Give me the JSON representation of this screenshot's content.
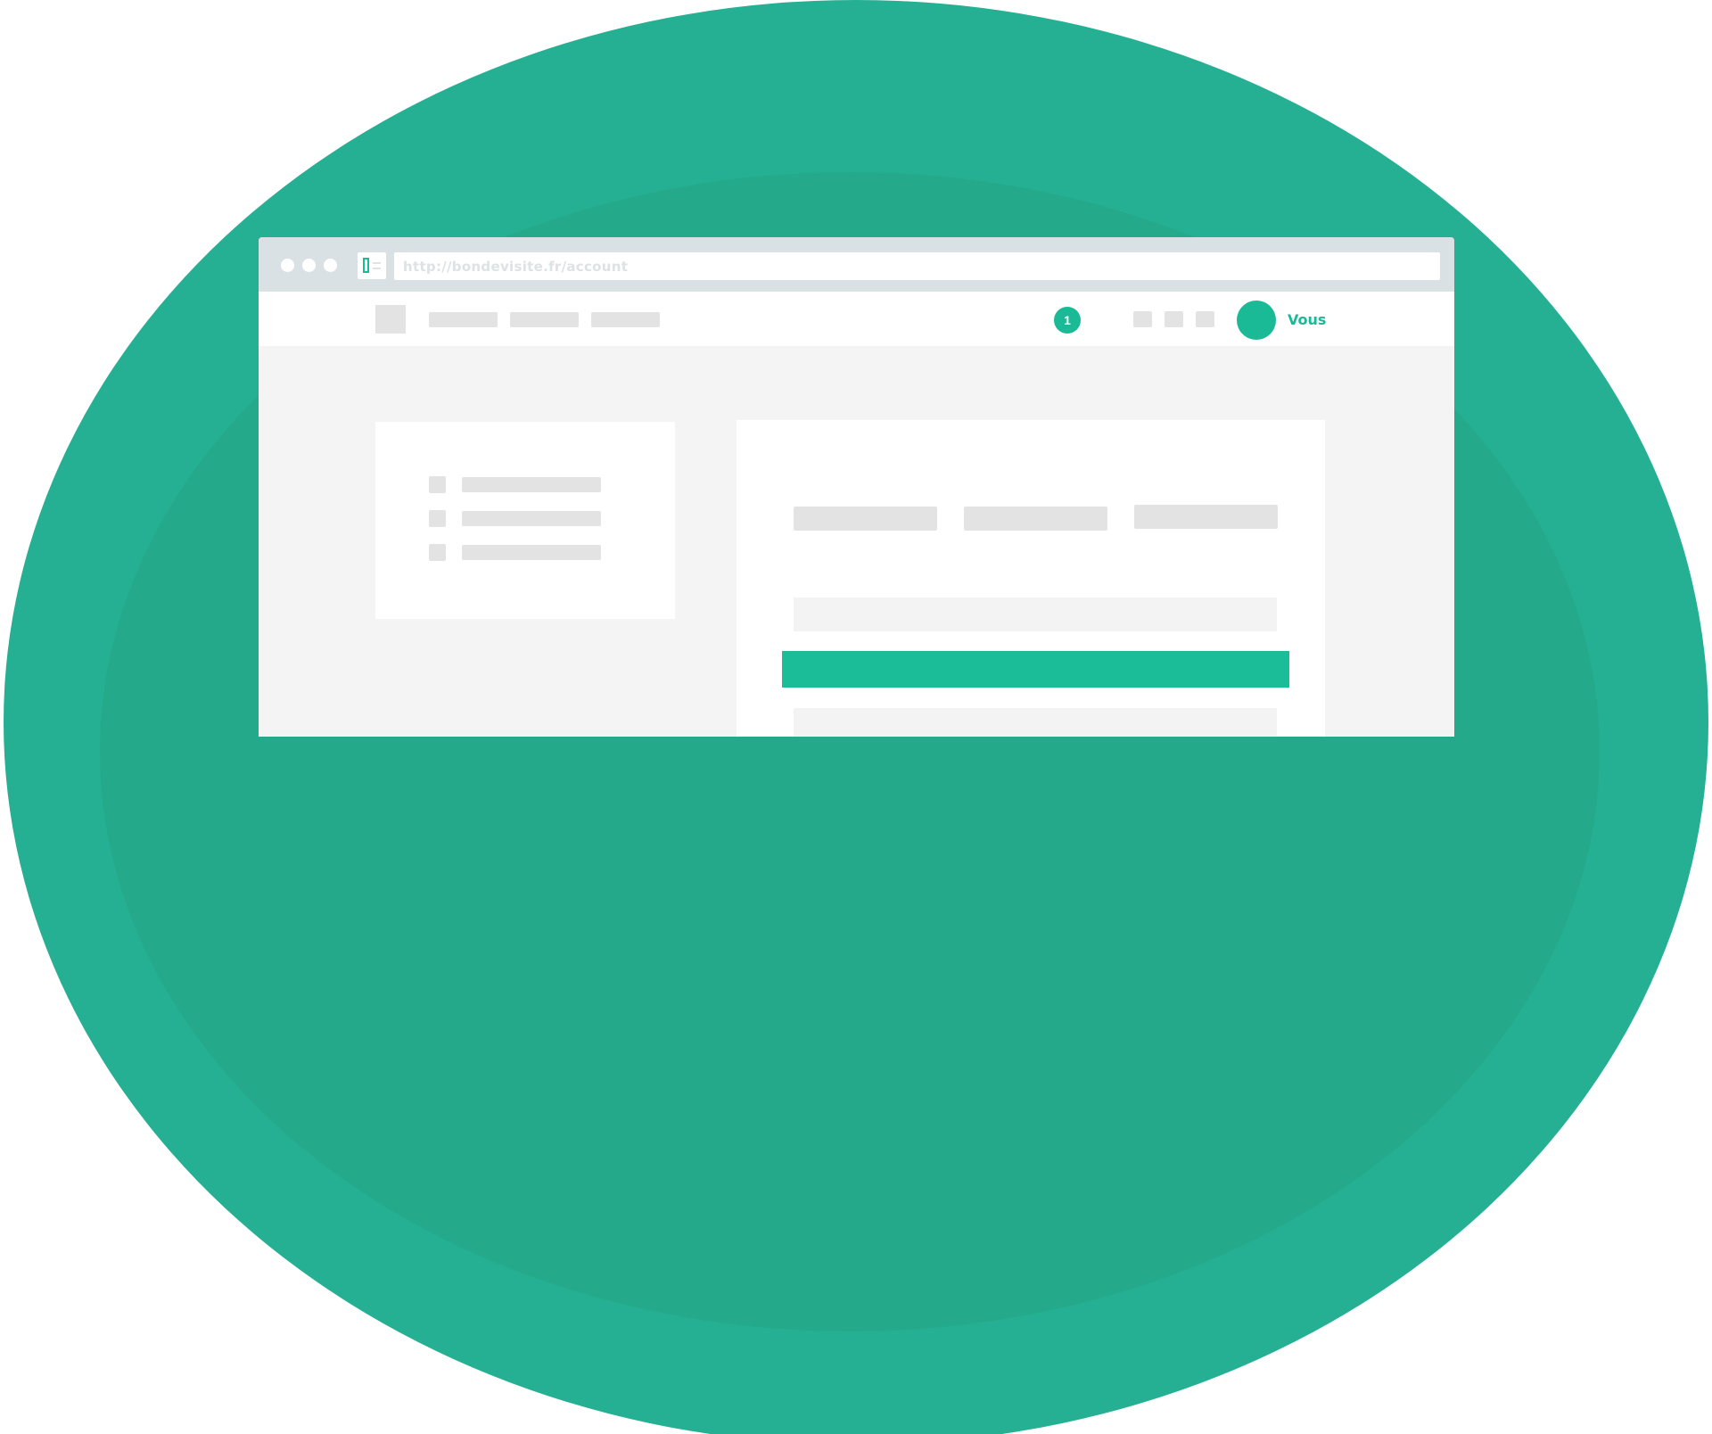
{
  "browser": {
    "url": "http://bondevisite.fr/account"
  },
  "nav": {
    "notification_count": "1",
    "user_label": "Vous"
  },
  "colors": {
    "accent": "#1aba97",
    "background_outer": "#26b093",
    "background_inner": "#24a98b",
    "placeholder": "#e3e3e3",
    "window_chrome": "#d9e1e5"
  }
}
